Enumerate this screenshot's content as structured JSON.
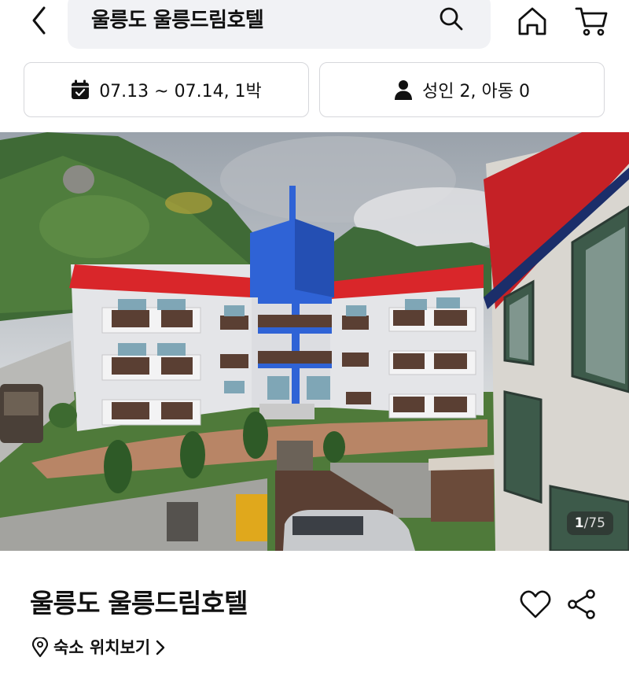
{
  "header": {
    "search_value": "울릉도 울릉드림호텔",
    "icons": [
      "back-icon",
      "search-icon",
      "home-icon",
      "cart-icon"
    ]
  },
  "filters": {
    "date_label": "07.13 ~ 07.14, 1박",
    "guest_label": "성인 2, 아동 0"
  },
  "gallery": {
    "current": "1",
    "total": "/75"
  },
  "hotel": {
    "name": "울릉도 울릉드림호텔",
    "location_link": "숙소 위치보기"
  },
  "colors": {
    "roof_red": "#d9262a",
    "tower_blue": "#2f63d6",
    "pill_border": "#d6d7db",
    "search_bg": "#f1f2f5"
  }
}
